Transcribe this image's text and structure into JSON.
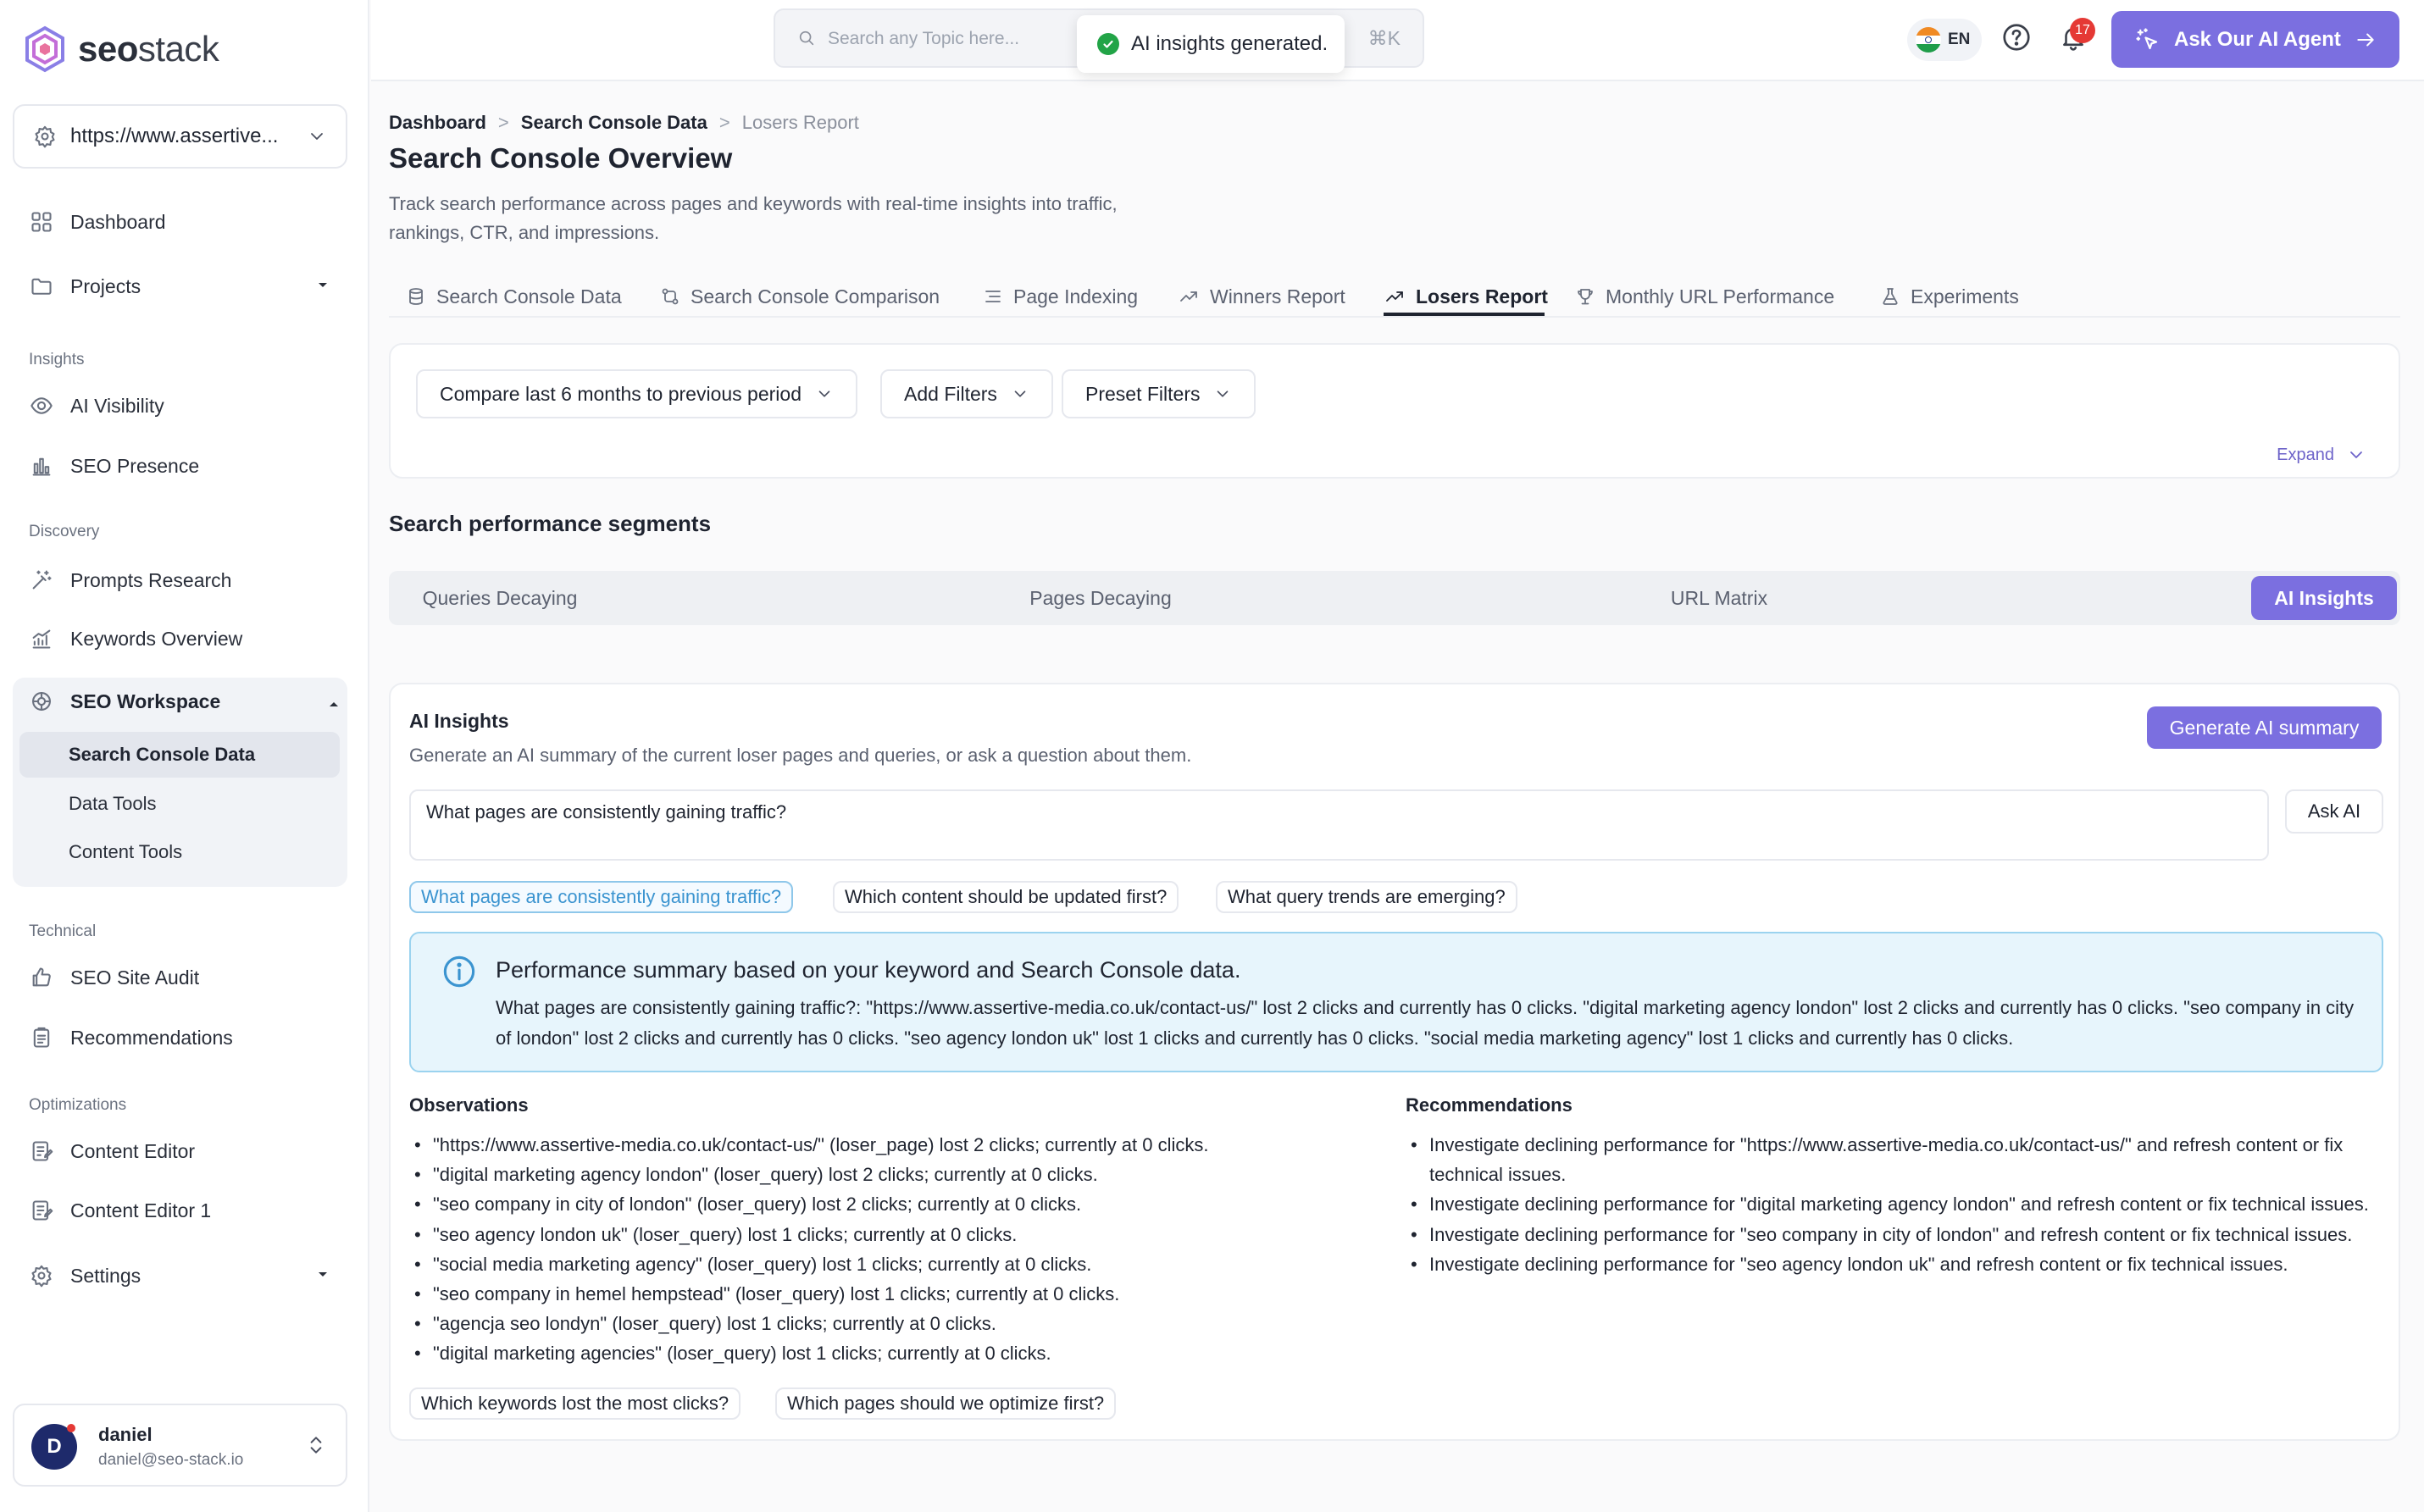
{
  "brand": {
    "name_bold": "seo",
    "name_light": "stack"
  },
  "site_selector": {
    "value": "https://www.assertive..."
  },
  "sidebar": {
    "dashboard": "Dashboard",
    "projects": "Projects",
    "section_insights": "Insights",
    "ai_visibility": "AI Visibility",
    "seo_presence": "SEO Presence",
    "section_discovery": "Discovery",
    "prompts_research": "Prompts Research",
    "keywords_overview": "Keywords Overview",
    "seo_workspace": "SEO Workspace",
    "workspace_items": [
      "Search Console Data",
      "Data Tools",
      "Content Tools"
    ],
    "section_technical": "Technical",
    "seo_site_audit": "SEO Site Audit",
    "recommendations": "Recommendations",
    "section_optimizations": "Optimizations",
    "content_editor": "Content Editor",
    "content_editor_1": "Content Editor 1",
    "settings": "Settings"
  },
  "user": {
    "initial": "D",
    "name": "daniel",
    "email": "daniel@seo-stack.io"
  },
  "topbar": {
    "search_placeholder": "Search any Topic here...",
    "search_shortcut": "⌘K",
    "toast": "AI insights generated.",
    "language": "EN",
    "notifications_count": "17",
    "agent_button": "Ask Our AI Agent"
  },
  "breadcrumb": [
    "Dashboard",
    "Search Console Data",
    "Losers Report"
  ],
  "page": {
    "title": "Search Console Overview",
    "description": "Track search performance across pages and keywords with real-time insights into traffic, rankings, CTR, and impressions."
  },
  "tabs": [
    "Search Console Data",
    "Search Console Comparison",
    "Page Indexing",
    "Winners Report",
    "Losers Report",
    "Monthly URL Performance",
    "Experiments"
  ],
  "filters": {
    "compare": "Compare last 6 months to previous period",
    "add_filters": "Add Filters",
    "preset_filters": "Preset Filters",
    "expand": "Expand"
  },
  "segments": {
    "title": "Search performance segments",
    "items": [
      "Queries Decaying",
      "Pages Decaying",
      "URL Matrix",
      "AI Insights"
    ]
  },
  "ai_insights": {
    "title": "AI Insights",
    "subtitle": "Generate an AI summary of the current loser pages and queries, or ask a question about them.",
    "generate_button": "Generate AI summary",
    "question": "What pages are consistently gaining traffic?",
    "ask_button": "Ask AI",
    "suggestions": [
      "What pages are consistently gaining traffic?",
      "Which content should be updated first?",
      "What query trends are emerging?"
    ],
    "summary_title": "Performance summary based on your keyword and Search Console data.",
    "summary_text": "What pages are consistently gaining traffic?: \"https://www.assertive-media.co.uk/contact-us/\" lost 2 clicks and currently has 0 clicks. \"digital marketing agency london\" lost 2 clicks and currently has 0 clicks. \"seo company in city of london\" lost 2 clicks and currently has 0 clicks. \"seo agency london uk\" lost 1 clicks and currently has 0 clicks. \"social media marketing agency\" lost 1 clicks and currently has 0 clicks.",
    "observations_title": "Observations",
    "observations": [
      "\"https://www.assertive-media.co.uk/contact-us/\" (loser_page) lost 2 clicks; currently at 0 clicks.",
      "\"digital marketing agency london\" (loser_query) lost 2 clicks; currently at 0 clicks.",
      "\"seo company in city of london\" (loser_query) lost 2 clicks; currently at 0 clicks.",
      "\"seo agency london uk\" (loser_query) lost 1 clicks; currently at 0 clicks.",
      "\"social media marketing agency\" (loser_query) lost 1 clicks; currently at 0 clicks.",
      "\"seo company in hemel hempstead\" (loser_query) lost 1 clicks; currently at 0 clicks.",
      "\"agencja seo londyn\" (loser_query) lost 1 clicks; currently at 0 clicks.",
      "\"digital marketing agencies\" (loser_query) lost 1 clicks; currently at 0 clicks."
    ],
    "recommendations_title": "Recommendations",
    "recommendations": [
      "Investigate declining performance for \"https://www.assertive-media.co.uk/contact-us/\" and refresh content or fix technical issues.",
      "Investigate declining performance for \"digital marketing agency london\" and refresh content or fix technical issues.",
      "Investigate declining performance for \"seo company in city of london\" and refresh content or fix technical issues.",
      "Investigate declining performance for \"seo agency london uk\" and refresh content or fix technical issues."
    ],
    "followups": [
      "Which keywords lost the most clicks?",
      "Which pages should we optimize first?"
    ]
  },
  "colors": {
    "accent": "#7b6fe0",
    "info_bg": "#e7f5fc",
    "success": "#22a447",
    "badge": "#e53935"
  }
}
